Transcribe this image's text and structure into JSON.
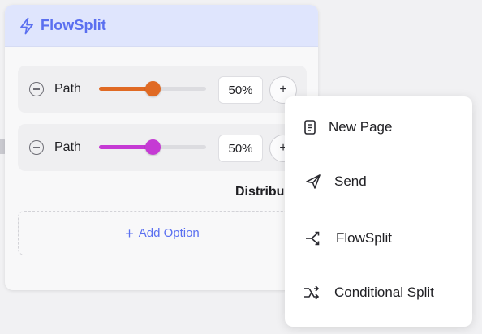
{
  "node": {
    "title": "FlowSplit",
    "icon": "lightning-bolt-icon",
    "accent_color": "#5a6ff0",
    "header_bg": "#dfe5fd",
    "paths": [
      {
        "label": "Path",
        "percent_text": "50%",
        "value": 0.5,
        "color": "#e06a24",
        "add_symbol": "+"
      },
      {
        "label": "Path",
        "percent_text": "50%",
        "value": 0.5,
        "color": "#c53ad4",
        "add_symbol": "+"
      }
    ],
    "distribute_label": "Distribu",
    "add_option": {
      "symbol": "+",
      "label": "Add Option"
    }
  },
  "menu": {
    "items": [
      {
        "label": "New Page",
        "icon": "document-icon"
      },
      {
        "label": "Send",
        "icon": "paper-plane-icon"
      },
      {
        "label": "FlowSplit",
        "icon": "split-arrows-icon"
      },
      {
        "label": "Conditional Split",
        "icon": "conditional-split-icon"
      }
    ]
  }
}
